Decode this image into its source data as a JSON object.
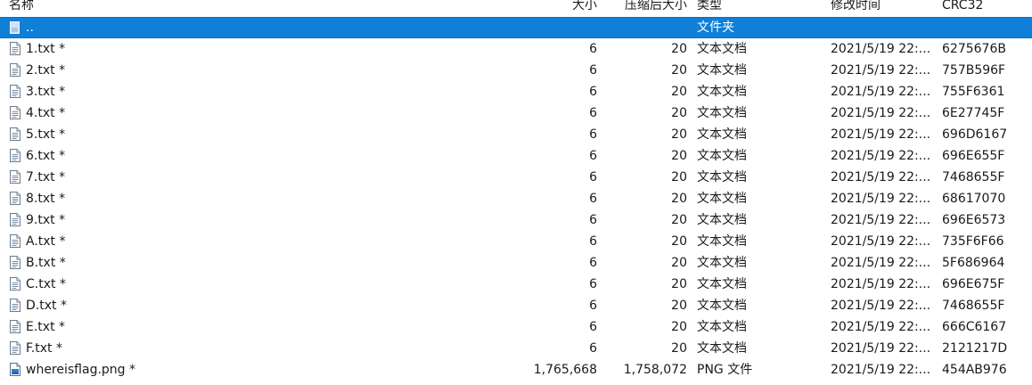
{
  "columns": {
    "name": "名称",
    "size": "大小",
    "packed": "压缩后大小",
    "type": "类型",
    "mtime": "修改时间",
    "crc": "CRC32"
  },
  "parent": {
    "name": "..",
    "type": "文件夹",
    "icon": "folder-up-icon"
  },
  "files": [
    {
      "name": "1.txt *",
      "size": "6",
      "packed": "20",
      "type": "文本文档",
      "mtime": "2021/5/19 22:...",
      "crc": "6275676B",
      "icon": "text-file-icon"
    },
    {
      "name": "2.txt *",
      "size": "6",
      "packed": "20",
      "type": "文本文档",
      "mtime": "2021/5/19 22:...",
      "crc": "757B596F",
      "icon": "text-file-icon"
    },
    {
      "name": "3.txt *",
      "size": "6",
      "packed": "20",
      "type": "文本文档",
      "mtime": "2021/5/19 22:...",
      "crc": "755F6361",
      "icon": "text-file-icon"
    },
    {
      "name": "4.txt *",
      "size": "6",
      "packed": "20",
      "type": "文本文档",
      "mtime": "2021/5/19 22:...",
      "crc": "6E27745F",
      "icon": "text-file-icon"
    },
    {
      "name": "5.txt *",
      "size": "6",
      "packed": "20",
      "type": "文本文档",
      "mtime": "2021/5/19 22:...",
      "crc": "696D6167",
      "icon": "text-file-icon"
    },
    {
      "name": "6.txt *",
      "size": "6",
      "packed": "20",
      "type": "文本文档",
      "mtime": "2021/5/19 22:...",
      "crc": "696E655F",
      "icon": "text-file-icon"
    },
    {
      "name": "7.txt *",
      "size": "6",
      "packed": "20",
      "type": "文本文档",
      "mtime": "2021/5/19 22:...",
      "crc": "7468655F",
      "icon": "text-file-icon"
    },
    {
      "name": "8.txt *",
      "size": "6",
      "packed": "20",
      "type": "文本文档",
      "mtime": "2021/5/19 22:...",
      "crc": "68617070",
      "icon": "text-file-icon"
    },
    {
      "name": "9.txt *",
      "size": "6",
      "packed": "20",
      "type": "文本文档",
      "mtime": "2021/5/19 22:...",
      "crc": "696E6573",
      "icon": "text-file-icon"
    },
    {
      "name": "A.txt *",
      "size": "6",
      "packed": "20",
      "type": "文本文档",
      "mtime": "2021/5/19 22:...",
      "crc": "735F6F66",
      "icon": "text-file-icon"
    },
    {
      "name": "B.txt *",
      "size": "6",
      "packed": "20",
      "type": "文本文档",
      "mtime": "2021/5/19 22:...",
      "crc": "5F686964",
      "icon": "text-file-icon"
    },
    {
      "name": "C.txt *",
      "size": "6",
      "packed": "20",
      "type": "文本文档",
      "mtime": "2021/5/19 22:...",
      "crc": "696E675F",
      "icon": "text-file-icon"
    },
    {
      "name": "D.txt *",
      "size": "6",
      "packed": "20",
      "type": "文本文档",
      "mtime": "2021/5/19 22:...",
      "crc": "7468655F",
      "icon": "text-file-icon"
    },
    {
      "name": "E.txt *",
      "size": "6",
      "packed": "20",
      "type": "文本文档",
      "mtime": "2021/5/19 22:...",
      "crc": "666C6167",
      "icon": "text-file-icon"
    },
    {
      "name": "F.txt *",
      "size": "6",
      "packed": "20",
      "type": "文本文档",
      "mtime": "2021/5/19 22:...",
      "crc": "2121217D",
      "icon": "text-file-icon"
    },
    {
      "name": "whereisflag.png *",
      "size": "1,765,668",
      "packed": "1,758,072",
      "type": "PNG 文件",
      "mtime": "2021/5/19 22:...",
      "crc": "454AB976",
      "icon": "image-file-icon"
    }
  ],
  "colors": {
    "selection": "#0f7fd8",
    "text": "#1a1a1a",
    "background": "#ffffff"
  }
}
